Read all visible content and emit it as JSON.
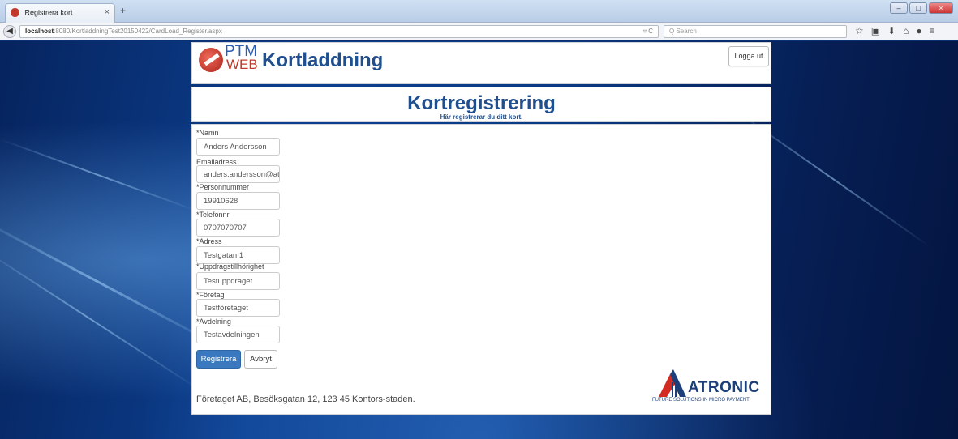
{
  "browser": {
    "tab_title": "Registrera kort",
    "tab_close": "×",
    "new_tab": "+",
    "url_host": "localhost",
    "url_rest": ":8080/KortladdningTest20150422/CardLoad_Register.aspx",
    "reload": "▿ C",
    "search_placeholder": "Q Search",
    "icons": [
      "star-icon",
      "bookmarks-icon",
      "download-icon",
      "home-icon",
      "chat-icon",
      "menu-icon"
    ]
  },
  "header": {
    "logo_ptm": "PTM",
    "logo_web": "WEB",
    "app_title": "Kortladdning",
    "logout_label": "Logga ut"
  },
  "page": {
    "title": "Kortregistrering",
    "subtitle": "Här registrerar du ditt kort."
  },
  "form": {
    "fields": [
      {
        "label": "*Namn",
        "value": "Anders Andersson"
      },
      {
        "label": "Emailadress",
        "value": "anders.andersson@atr"
      },
      {
        "label": "*Personnummer",
        "value": "19910628"
      },
      {
        "label": "*Telefonnr",
        "value": "0707070707"
      },
      {
        "label": "*Adress",
        "value": "Testgatan 1"
      },
      {
        "label": "*Uppdragstillhörighet",
        "value": "Testuppdraget"
      },
      {
        "label": "*Företag",
        "value": "Testföretaget"
      },
      {
        "label": "*Avdelning",
        "value": "Testavdelningen"
      }
    ],
    "submit_label": "Registrera",
    "cancel_label": "Avbryt"
  },
  "footer": {
    "address": "Företaget AB, Besöksgatan 12, 123 45 Kontors-staden.",
    "brand": "ATRONIC",
    "tagline": "FUTURE SOLUTIONS IN MICRO PAYMENT"
  },
  "colors": {
    "accent": "#1f4f8f",
    "primary_button": "#3a79bf",
    "brand_red": "#c0392b"
  }
}
